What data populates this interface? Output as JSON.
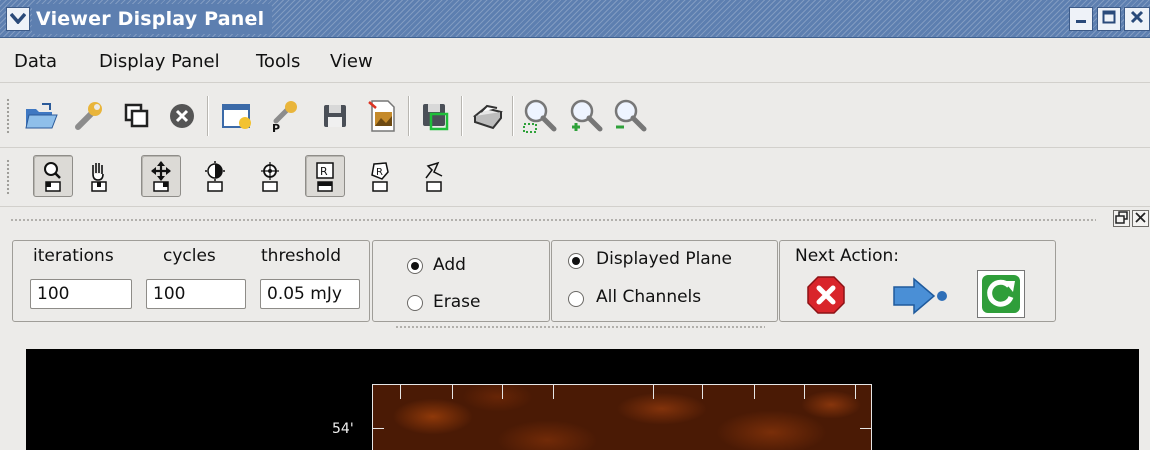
{
  "window": {
    "title": "Viewer Display Panel"
  },
  "menu": [
    {
      "label": "Data"
    },
    {
      "label": "Display Panel"
    },
    {
      "label": "Tools"
    },
    {
      "label": "View"
    }
  ],
  "main_toolbar": {
    "icons": [
      "open-folder-icon",
      "wrench-icon",
      "copy-icon",
      "close-circle-icon",
      "new-panel-icon",
      "panel-options-icon",
      "save-icon",
      "export-image-icon",
      "save-region-icon",
      "print-icon",
      "zoom-fit-icon",
      "zoom-in-icon",
      "zoom-out-icon"
    ]
  },
  "mouse_toolbar": {
    "tools": [
      {
        "name": "zoom-tool",
        "pressed": true
      },
      {
        "name": "pan-tool",
        "pressed": false
      },
      {
        "name": "move-tool",
        "pressed": true
      },
      {
        "name": "contrast-tool",
        "pressed": false
      },
      {
        "name": "crosshair-tool",
        "pressed": false
      },
      {
        "name": "rectangle-region-tool",
        "pressed": true
      },
      {
        "name": "polygon-region-tool",
        "pressed": false
      },
      {
        "name": "polyline-tool",
        "pressed": false
      }
    ]
  },
  "clean": {
    "iterations_label": "iterations",
    "cycles_label": "cycles",
    "threshold_label": "threshold",
    "iterations_value": "100",
    "cycles_value": "100",
    "threshold_value": "0.05 mJy",
    "add_label": "Add",
    "erase_label": "Erase",
    "mask_mode": "Add",
    "displayed_plane_label": "Displayed Plane",
    "all_channels_label": "All Channels",
    "plane_mode": "Displayed Plane",
    "next_action_label": "Next Action:"
  },
  "display": {
    "y_tick_label": "54'"
  },
  "colors": {
    "title_bar": "#5d7fb0",
    "stop_red": "#d9252b",
    "continue_blue": "#4a8fd6",
    "refresh_green": "#2f9e3a",
    "image_orange": "#8a3a0c"
  }
}
